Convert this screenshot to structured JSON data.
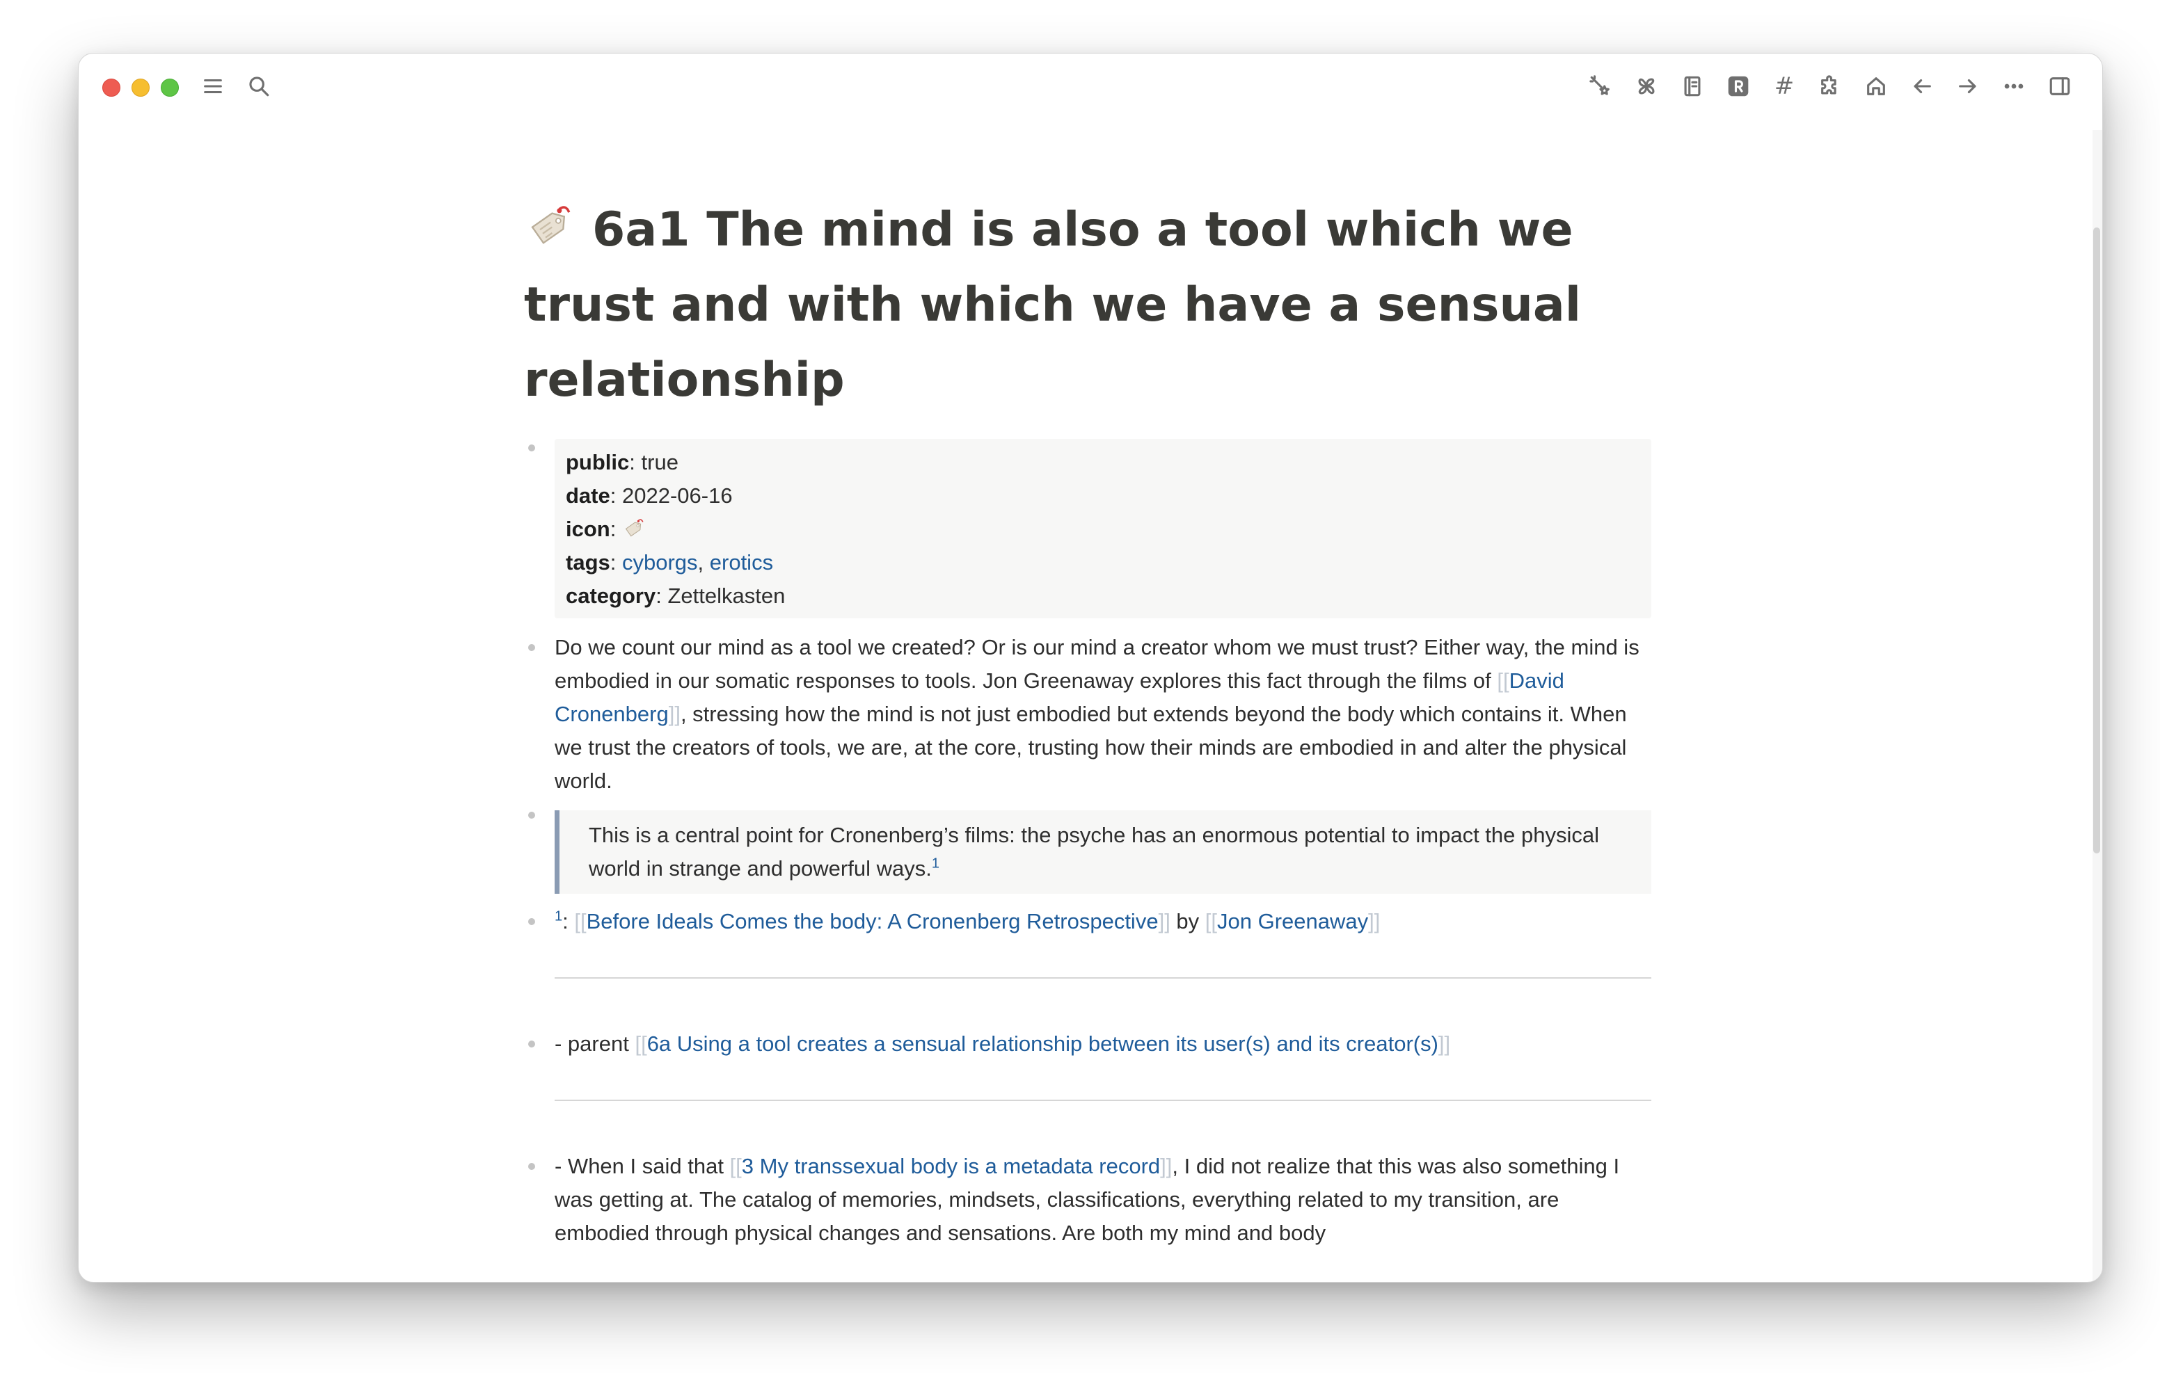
{
  "window": {
    "traffic_lights": [
      "close",
      "minimize",
      "zoom"
    ]
  },
  "toolbar_left": [
    {
      "icon": "menu-icon"
    },
    {
      "icon": "search-icon"
    }
  ],
  "toolbar_right": [
    {
      "icon": "magic-wand-icon"
    },
    {
      "icon": "pinwheel-icon"
    },
    {
      "icon": "book-icon"
    },
    {
      "icon": "r-badge-icon"
    },
    {
      "icon": "hashtag-icon",
      "glyph": "#"
    },
    {
      "icon": "puzzle-icon"
    },
    {
      "icon": "home-icon"
    },
    {
      "icon": "arrow-left-icon"
    },
    {
      "icon": "arrow-right-icon"
    },
    {
      "icon": "more-icon",
      "glyph": "···"
    },
    {
      "icon": "sidebar-toggle-icon"
    }
  ],
  "page": {
    "title": "6a1 The mind is also a tool which we trust and with which we have a sensual relationship",
    "icon": "price-tag-icon"
  },
  "properties": {
    "public_key": "public",
    "public_value": "true",
    "date_key": "date",
    "date_value": "2022-06-16",
    "icon_key": "icon",
    "tags_key": "tags",
    "tags": [
      "cyborgs",
      "erotics"
    ],
    "category_key": "category",
    "category_value": "Zettelkasten"
  },
  "para1": {
    "before": "Do we count our mind as a tool we created? Or is our mind a creator whom we must trust? Either way, the mind is embodied in our somatic responses to tools. Jon Greenaway explores this fact through the films of ",
    "link": "David Cronenberg",
    "after": ", stressing how the mind is not just embodied but extends beyond the body which contains it. When we trust the creators of tools, we are, at the core, trusting how their minds are embodied in and alter the physical world."
  },
  "quote": {
    "text": "This is a central point for Cronenberg’s films: the psyche has an enormous potential to impact the physical world in strange and powerful ways.",
    "footnote": "1"
  },
  "footnote": {
    "marker": "1",
    "colon": ": ",
    "link1": "Before Ideals Comes the body: A Cronenberg Retrospective",
    "by": " by ",
    "link2": "Jon Greenaway"
  },
  "parent": {
    "prefix": "- parent ",
    "link": "6a Using a tool creates a sensual relationship between its user(s) and its creator(s)"
  },
  "para2": {
    "before": "- When I said that ",
    "link": "3 My transsexual body is a metadata record",
    "after": ", I did not realize that this was also something I was getting at. The catalog of memories, mindsets, classifications, everything related to my transition, are embodied through physical changes and sensations. Are both my mind and body"
  },
  "brackets": {
    "open": "[[",
    "close": "]]"
  }
}
